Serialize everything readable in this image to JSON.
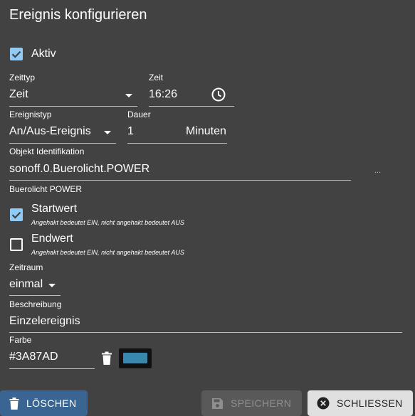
{
  "dialog": {
    "title": "Ereignis konfigurieren"
  },
  "active": {
    "label": "Aktiv",
    "checked": true
  },
  "time_type": {
    "caption": "Zeittyp",
    "value": "Zeit"
  },
  "time": {
    "caption": "Zeit",
    "value": "16:26",
    "icon": "clock-icon"
  },
  "event_type": {
    "caption": "Ereignistyp",
    "value": "An/Aus-Ereignis"
  },
  "duration": {
    "caption": "Dauer",
    "value": "1",
    "unit": "Minuten"
  },
  "object_id": {
    "caption": "Objekt Identifikation",
    "value": "sonoff.0.Buerolicht.POWER",
    "more_label": "...",
    "object_name": "Buerolicht POWER"
  },
  "start_value": {
    "label": "Startwert",
    "hint": "Angehakt bedeutet EIN, nicht angehakt bedeutet AUS",
    "checked": true
  },
  "end_value": {
    "label": "Endwert",
    "hint": "Angehakt bedeutet EIN, nicht angehakt bedeutet AUS",
    "checked": false
  },
  "period": {
    "caption": "Zeitraum",
    "value": "einmal"
  },
  "description": {
    "caption": "Beschreibung",
    "value": "Einzelereignis"
  },
  "color": {
    "caption": "Farbe",
    "value": "#3A87AD",
    "swatch": "#3A87AD"
  },
  "buttons": {
    "delete": "LÖSCHEN",
    "save": "SPEICHERN",
    "close": "SCHLIESSEN"
  },
  "colors": {
    "background": "#424242",
    "accent": "#90caf9",
    "delete_button": "#3a6592",
    "save_button_disabled": "#595959",
    "close_button": "#e0e0e0"
  }
}
